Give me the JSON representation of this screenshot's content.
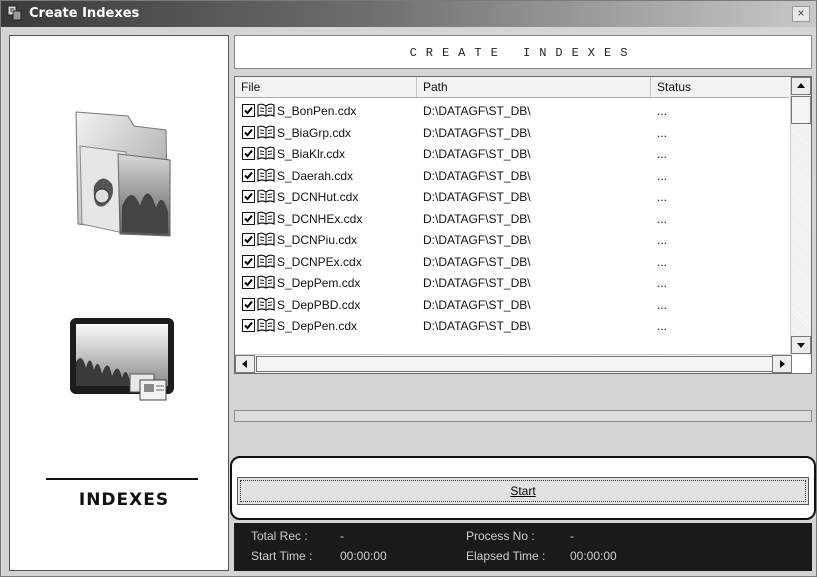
{
  "window": {
    "title": "Create Indexes",
    "close_label": "×"
  },
  "header": {
    "title": "CREATE INDEXES"
  },
  "logo": {
    "text": "INDEXES"
  },
  "list": {
    "columns": [
      "File",
      "Path",
      "Status"
    ],
    "rows": [
      {
        "file": "S_BonPen.cdx",
        "path": "D:\\DATAGF\\ST_DB\\",
        "status": "...",
        "checked": true
      },
      {
        "file": "S_BiaGrp.cdx",
        "path": "D:\\DATAGF\\ST_DB\\",
        "status": "...",
        "checked": true
      },
      {
        "file": "S_BiaKlr.cdx",
        "path": "D:\\DATAGF\\ST_DB\\",
        "status": "...",
        "checked": true
      },
      {
        "file": "S_Daerah.cdx",
        "path": "D:\\DATAGF\\ST_DB\\",
        "status": "...",
        "checked": true
      },
      {
        "file": "S_DCNHut.cdx",
        "path": "D:\\DATAGF\\ST_DB\\",
        "status": "...",
        "checked": true
      },
      {
        "file": "S_DCNHEx.cdx",
        "path": "D:\\DATAGF\\ST_DB\\",
        "status": "...",
        "checked": true
      },
      {
        "file": "S_DCNPiu.cdx",
        "path": "D:\\DATAGF\\ST_DB\\",
        "status": "...",
        "checked": true
      },
      {
        "file": "S_DCNPEx.cdx",
        "path": "D:\\DATAGF\\ST_DB\\",
        "status": "...",
        "checked": true
      },
      {
        "file": "S_DepPem.cdx",
        "path": "D:\\DATAGF\\ST_DB\\",
        "status": "...",
        "checked": true
      },
      {
        "file": "S_DepPBD.cdx",
        "path": "D:\\DATAGF\\ST_DB\\",
        "status": "...",
        "checked": true
      },
      {
        "file": "S_DepPen.cdx",
        "path": "D:\\DATAGF\\ST_DB\\",
        "status": "...",
        "checked": true
      }
    ]
  },
  "progress": {
    "fraction": 0
  },
  "start_button": {
    "label": "Start"
  },
  "status": {
    "total_rec_label": "Total Rec :",
    "total_rec_value": "-",
    "process_no_label": "Process No :",
    "process_no_value": "-",
    "start_time_label": "Start Time :",
    "start_time_value": "00:00:00",
    "elapsed_time_label": "Elapsed Time :",
    "elapsed_time_value": "00:00:00"
  },
  "icons": [
    "app-icon",
    "close-icon",
    "folder-art-icon",
    "picture-frame-art-icon",
    "checkbox-icon",
    "book-icon",
    "scroll-up-icon",
    "scroll-down-icon",
    "scroll-left-icon",
    "scroll-right-icon"
  ]
}
